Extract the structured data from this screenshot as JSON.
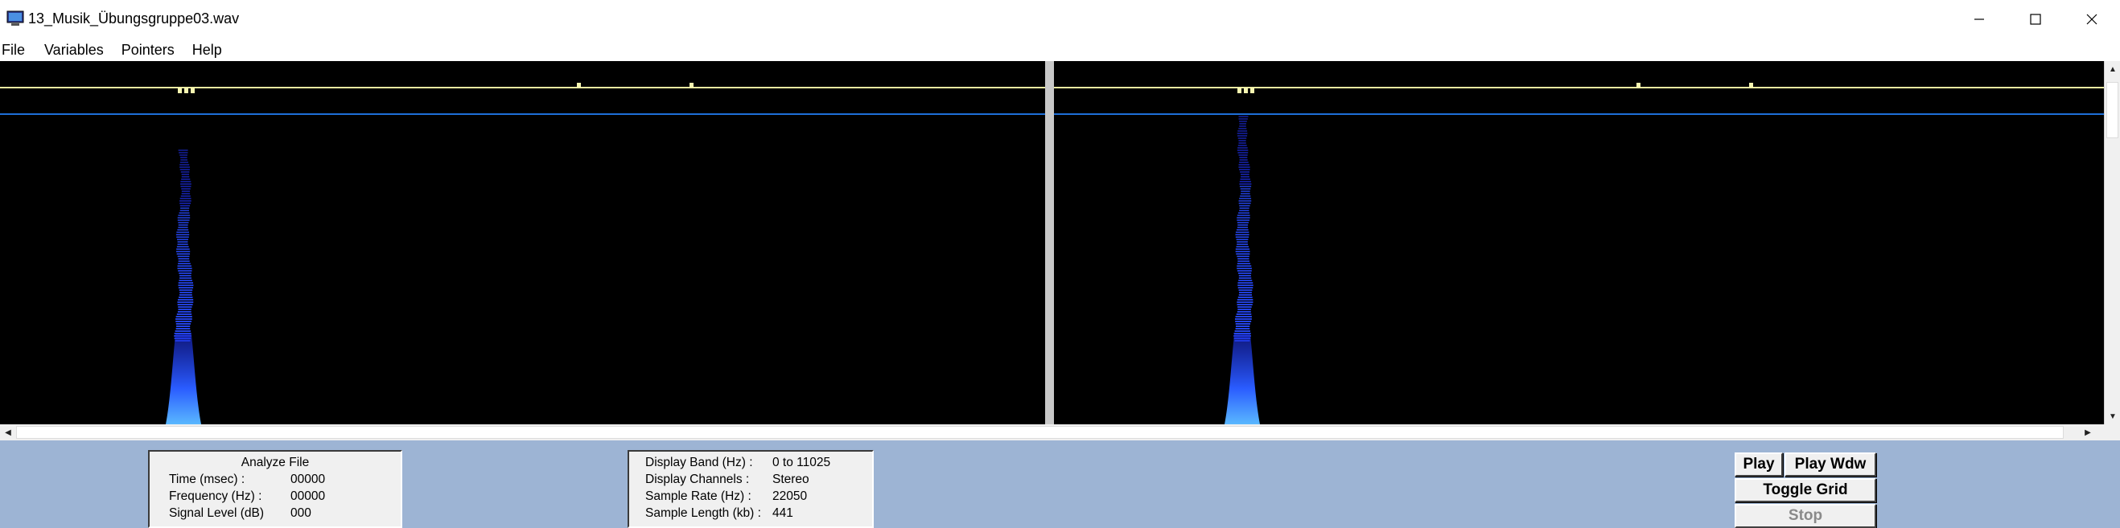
{
  "window": {
    "title": "13_Musik_Übungsgruppe03.wav",
    "minimize_icon": "minimize-icon",
    "maximize_icon": "maximize-icon",
    "close_icon": "close-icon"
  },
  "menu": {
    "items": [
      "File",
      "Variables",
      "Pointers",
      "Help"
    ]
  },
  "analyze_panel": {
    "heading": "Analyze File",
    "rows": [
      {
        "label": "Time (msec) :",
        "value": "00000"
      },
      {
        "label": "Frequency (Hz) :",
        "value": "00000"
      },
      {
        "label": "Signal Level (dB)",
        "value": "000"
      }
    ]
  },
  "display_panel": {
    "rows": [
      {
        "label": "Display Band (Hz) :",
        "value": "0 to 11025"
      },
      {
        "label": "Display Channels :",
        "value": "Stereo"
      },
      {
        "label": "Sample Rate (Hz) :",
        "value": "22050"
      },
      {
        "label": "Sample Length (kb) :",
        "value": "441"
      }
    ]
  },
  "controls": {
    "play": "Play",
    "play_window": "Play Wdw",
    "toggle_grid": "Toggle Grid",
    "stop": "Stop"
  },
  "colors": {
    "spectrogram_bg": "#000000",
    "yellow_line": "#e8e8a0",
    "blue_line": "#1e6fd8",
    "panel_bg": "#9db4d4",
    "signal_blue": "#2a4cff"
  }
}
